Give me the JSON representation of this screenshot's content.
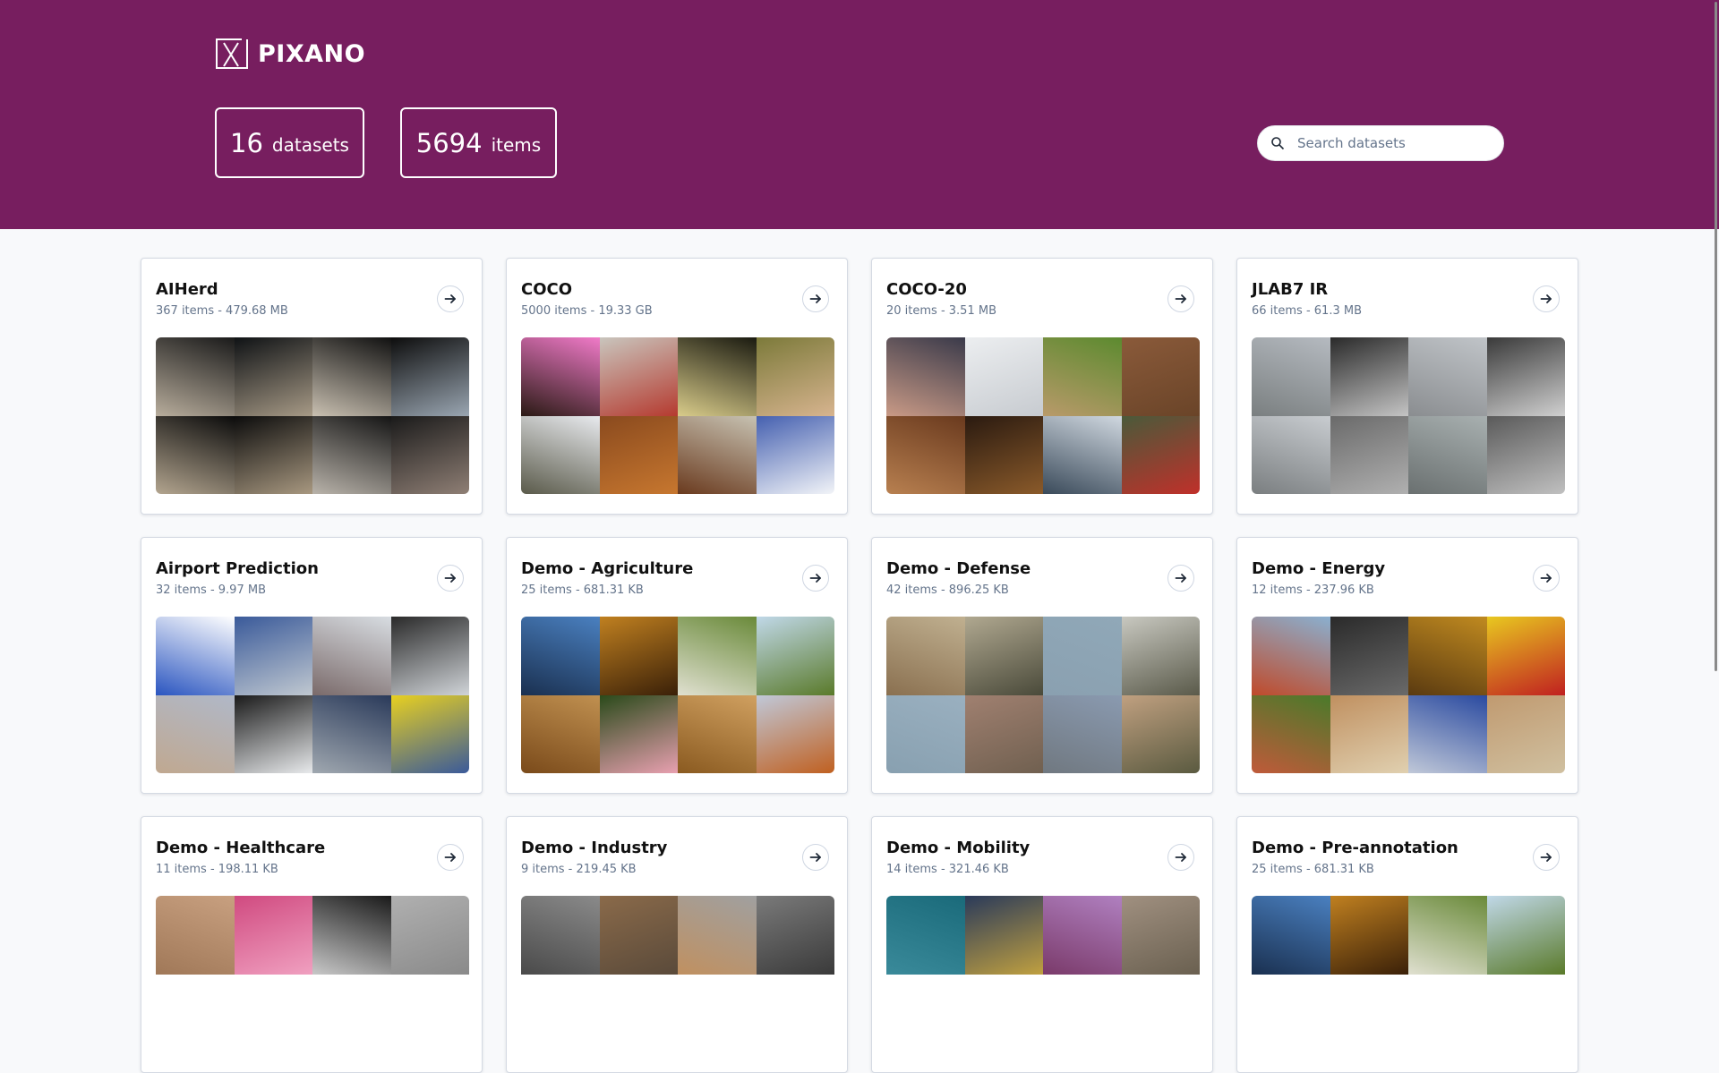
{
  "app": {
    "name": "PIXANO",
    "logo_icon": "pixano-logo-icon"
  },
  "colors": {
    "header_bg": "#771e5f",
    "page_bg": "#f8f9fb",
    "subtitle": "#64748b"
  },
  "stats": [
    {
      "value": "16",
      "label": "datasets"
    },
    {
      "value": "5694",
      "label": "items"
    }
  ],
  "search": {
    "placeholder": "Search datasets",
    "value": "",
    "icon": "search-icon"
  },
  "datasets": [
    {
      "name": "AIHerd",
      "info": "367 items - 479.68 MB",
      "thumbs": [
        [
          "#1a1a1a",
          "#b8ad9c"
        ],
        [
          "#0f1215",
          "#a79a86"
        ],
        [
          "#111",
          "#c9c0b1"
        ],
        [
          "#0d0d0d",
          "#9aa6b2"
        ],
        [
          "#0b0b0b",
          "#b3a58f"
        ],
        [
          "#0c0c0c",
          "#a89880"
        ],
        [
          "#151515",
          "#b9b3aa"
        ],
        [
          "#1a1a1a",
          "#8f7f75"
        ]
      ]
    },
    {
      "name": "COCO",
      "info": "5000 items - 19.33 GB",
      "thumbs": [
        [
          "#f07ac8",
          "#2a1a14"
        ],
        [
          "#c9c5bd",
          "#b53a2f"
        ],
        [
          "#1a1a10",
          "#d9cc8a"
        ],
        [
          "#7c7a3a",
          "#d7b48f"
        ],
        [
          "#e8eaee",
          "#5a5a4a"
        ],
        [
          "#8a4a1e",
          "#c7772f"
        ],
        [
          "#c7c2b2",
          "#6a3a1e"
        ],
        [
          "#4560b0",
          "#f2f4f8"
        ]
      ]
    },
    {
      "name": "COCO-20",
      "info": "20 items - 3.51 MB",
      "thumbs": [
        [
          "#3a3a4a",
          "#c99a86"
        ],
        [
          "#eceef0",
          "#c7cbd0"
        ],
        [
          "#5c8a2f",
          "#b99a6a"
        ],
        [
          "#8a5a3a",
          "#6a4428"
        ],
        [
          "#6a3a1e",
          "#b88050"
        ],
        [
          "#2a1a10",
          "#8a5a2a"
        ],
        [
          "#d0d8e0",
          "#3a4a5a"
        ],
        [
          "#4a5a3a",
          "#c0302a"
        ]
      ]
    },
    {
      "name": "JLAB7 IR",
      "info": "66 items - 61.3 MB",
      "thumbs": [
        [
          "#b5bac0",
          "#7a7f80"
        ],
        [
          "#2a2a2a",
          "#c4c4c4"
        ],
        [
          "#c0c4c8",
          "#8a8d90"
        ],
        [
          "#3a3a3a",
          "#d0d0d0"
        ],
        [
          "#c8ccd0",
          "#7a7e80"
        ],
        [
          "#6a6a6a",
          "#b0b0b0"
        ],
        [
          "#a8b0b0",
          "#6a7070"
        ],
        [
          "#5a5a5a",
          "#c0c0c0"
        ]
      ]
    },
    {
      "name": "Airport Prediction",
      "info": "32 items - 9.97 MB",
      "thumbs": [
        [
          "#ffffff",
          "#2a55c0"
        ],
        [
          "#3a5a9a",
          "#c0c8d0"
        ],
        [
          "#d8dde2",
          "#7a6a6a"
        ],
        [
          "#2a2a2a",
          "#d0d4d8"
        ],
        [
          "#b0b8c8",
          "#c0a890"
        ],
        [
          "#1a1a1a",
          "#e8eaec"
        ],
        [
          "#2a3a5a",
          "#a0a8b0"
        ],
        [
          "#e8d020",
          "#3a5a9a"
        ]
      ]
    },
    {
      "name": "Demo - Agriculture",
      "info": "25 items - 681.31 KB",
      "thumbs": [
        [
          "#4a80c0",
          "#1a3050"
        ],
        [
          "#c08020",
          "#3a2008"
        ],
        [
          "#6a8a3a",
          "#e0e0d0"
        ],
        [
          "#c0d8e8",
          "#5a7a2a"
        ],
        [
          "#c09050",
          "#7a4a1a"
        ],
        [
          "#2a4a1a",
          "#e8a0b0"
        ],
        [
          "#d0a060",
          "#8a5a20"
        ],
        [
          "#c0c8d8",
          "#c06020"
        ]
      ]
    },
    {
      "name": "Demo - Defense",
      "info": "42 items - 896.25 KB",
      "thumbs": [
        [
          "#c0b090",
          "#8a7050"
        ],
        [
          "#b0a890",
          "#4a4a3a"
        ],
        [
          "#90a8b8",
          "#8aa0b0"
        ],
        [
          "#c8c8c0",
          "#5a5a4a"
        ],
        [
          "#9ab0c0",
          "#88a0b0"
        ],
        [
          "#a08070",
          "#706050"
        ],
        [
          "#8a9ab0",
          "#707880"
        ],
        [
          "#c0a080",
          "#5a5a40"
        ]
      ]
    },
    {
      "name": "Demo - Energy",
      "info": "12 items - 237.96 KB",
      "thumbs": [
        [
          "#8ab0d0",
          "#c04a2a"
        ],
        [
          "#2a2a2a",
          "#6a6a6a"
        ],
        [
          "#c08a20",
          "#5a3a10"
        ],
        [
          "#e8c820",
          "#c02020"
        ],
        [
          "#4a7a2a",
          "#c05a3a"
        ],
        [
          "#c09060",
          "#e0d0b0"
        ],
        [
          "#2a4aa0",
          "#c0c8d8"
        ],
        [
          "#c09a70",
          "#d0c0a0"
        ]
      ]
    },
    {
      "name": "Demo - Healthcare",
      "info": "11 items - 198.11 KB",
      "thumbs": [
        [
          "#c8a080",
          "#a07858"
        ],
        [
          "#d04a80",
          "#f0a0c0"
        ],
        [
          "#1a1a1a",
          "#c8c8c8"
        ],
        [
          "#b0b0b0",
          "#8a8a8a"
        ]
      ]
    },
    {
      "name": "Demo - Industry",
      "info": "9 items - 219.45 KB",
      "thumbs": [
        [
          "#8a8a8a",
          "#4a4a4a"
        ],
        [
          "#8a6a4a",
          "#5a4a3a"
        ],
        [
          "#a0a0a0",
          "#c09060"
        ],
        [
          "#7a7a7a",
          "#3a3a3a"
        ]
      ]
    },
    {
      "name": "Demo - Mobility",
      "info": "14 items - 321.46 KB",
      "thumbs": [
        [
          "#1a6a7a",
          "#3a8a9a"
        ],
        [
          "#2a3a5a",
          "#c0a040"
        ],
        [
          "#b080c0",
          "#7a3a6a"
        ],
        [
          "#a09080",
          "#6a6050"
        ]
      ]
    },
    {
      "name": "Demo - Pre-annotation",
      "info": "25 items - 681.31 KB",
      "thumbs": [
        [
          "#4a80c0",
          "#1a3050"
        ],
        [
          "#c08020",
          "#3a2008"
        ],
        [
          "#6a8a3a",
          "#e0e0d0"
        ],
        [
          "#c0d8e8",
          "#5a7a2a"
        ]
      ]
    }
  ]
}
